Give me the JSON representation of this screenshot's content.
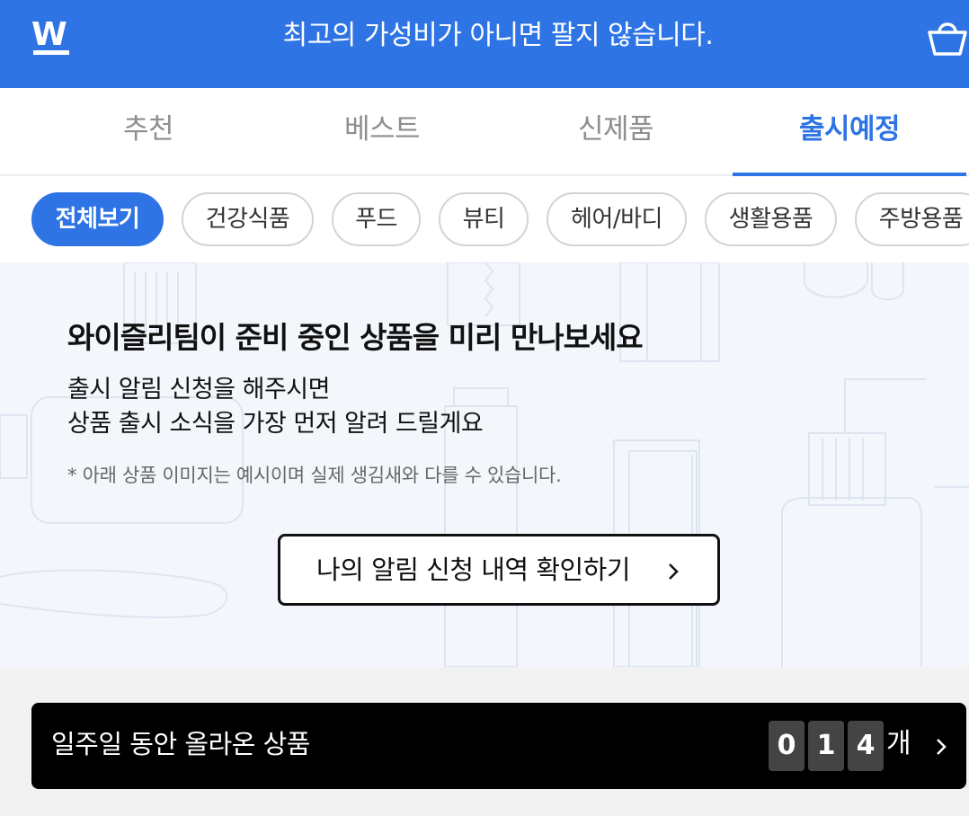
{
  "header": {
    "logo_letter": "W",
    "title": "최고의 가성비가 아니면 팔지 않습니다.",
    "cart_icon": "shopping-basket-icon",
    "brand_color": "#2f74e4"
  },
  "tabs": [
    {
      "label": "추천",
      "active": false
    },
    {
      "label": "베스트",
      "active": false
    },
    {
      "label": "신제품",
      "active": false
    },
    {
      "label": "출시예정",
      "active": true
    }
  ],
  "categories": [
    {
      "label": "전체보기",
      "active": true
    },
    {
      "label": "건강식품",
      "active": false
    },
    {
      "label": "푸드",
      "active": false
    },
    {
      "label": "뷰티",
      "active": false
    },
    {
      "label": "헤어/바디",
      "active": false
    },
    {
      "label": "생활용품",
      "active": false
    },
    {
      "label": "주방용품",
      "active": false
    }
  ],
  "hero": {
    "title": "와이즐리팀이 준비 중인 상품을 미리 만나보세요",
    "desc_line1": "출시 알림 신청을 해주시면",
    "desc_line2": "상품 출시 소식을 가장 먼저 알려 드릴게요",
    "note": "* 아래 상품 이미지는 예시이며 실제 생김새와 다를 수 있습니다.",
    "button_label": "나의 알림 신청 내역 확인하기",
    "button_icon": "chevron-right-icon"
  },
  "weekly": {
    "label": "일주일 동안 올라온 상품",
    "digits": [
      "0",
      "1",
      "4"
    ],
    "count": 14,
    "unit": "개",
    "icon": "chevron-right-icon"
  }
}
